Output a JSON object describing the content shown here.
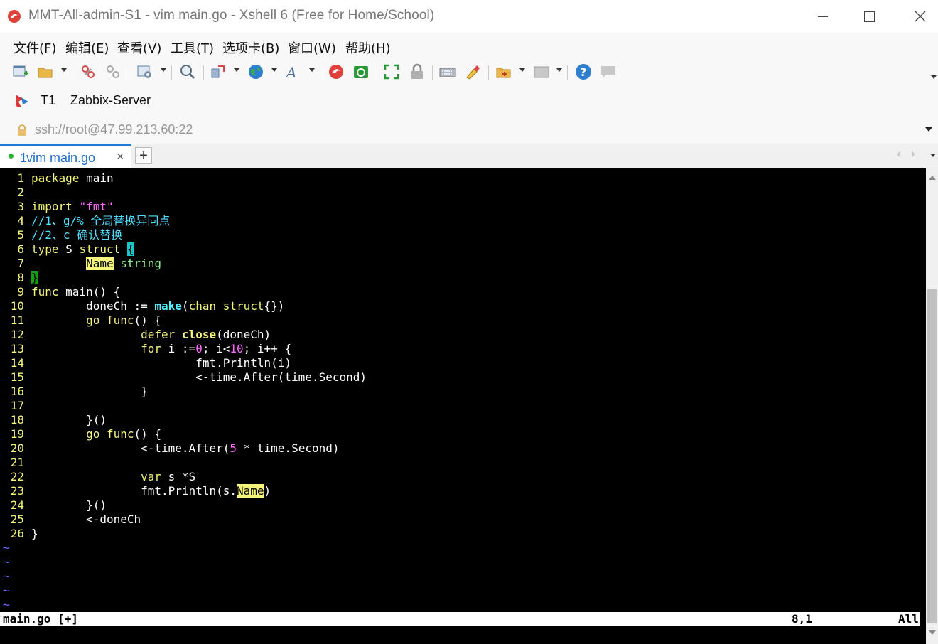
{
  "window": {
    "title": "MMT-All-admin-S1 - vim main.go - Xshell 6 (Free for Home/School)"
  },
  "menu": [
    "文件(F)",
    "编辑(E)",
    "查看(V)",
    "工具(T)",
    "选项卡(B)",
    "窗口(W)",
    "帮助(H)"
  ],
  "session": {
    "label": "T1",
    "name": "Zabbix-Server"
  },
  "address": {
    "value": "ssh://root@47.99.213.60:22"
  },
  "tab": {
    "index": "1",
    "label": " vim main.go",
    "close": "×",
    "add": "+"
  },
  "editor": {
    "status_file": "main.go [+]",
    "status_pos": "8,1",
    "status_scroll": "All",
    "tilde": "~"
  },
  "colors": {
    "accent": "#1e7bd7",
    "terminal_bg": "#000000",
    "line_number": "#f4f47a"
  },
  "code_lines": [
    {
      "n": "1",
      "t": "package main"
    },
    {
      "n": "2",
      "t": ""
    },
    {
      "n": "3",
      "t": "import \"fmt\""
    },
    {
      "n": "4",
      "t": "//1、g/% 全局替换异同点"
    },
    {
      "n": "5",
      "t": "//2、c 确认替换"
    },
    {
      "n": "6",
      "t": "type S struct {"
    },
    {
      "n": "7",
      "t": "        Name string"
    },
    {
      "n": "8",
      "t": "}"
    },
    {
      "n": "9",
      "t": "func main() {"
    },
    {
      "n": "10",
      "t": "        doneCh := make(chan struct{})"
    },
    {
      "n": "11",
      "t": "        go func() {"
    },
    {
      "n": "12",
      "t": "                defer close(doneCh)"
    },
    {
      "n": "13",
      "t": "                for i :=0; i<10; i++ {"
    },
    {
      "n": "14",
      "t": "                        fmt.Println(i)"
    },
    {
      "n": "15",
      "t": "                        <-time.After(time.Second)"
    },
    {
      "n": "16",
      "t": "                }"
    },
    {
      "n": "17",
      "t": ""
    },
    {
      "n": "18",
      "t": "        }()"
    },
    {
      "n": "19",
      "t": "        go func() {"
    },
    {
      "n": "20",
      "t": "                <-time.After(5 * time.Second)"
    },
    {
      "n": "21",
      "t": ""
    },
    {
      "n": "22",
      "t": "                var s *S"
    },
    {
      "n": "23",
      "t": "                fmt.Println(s.Name)"
    },
    {
      "n": "24",
      "t": "        }()"
    },
    {
      "n": "25",
      "t": "        <-doneCh"
    },
    {
      "n": "26",
      "t": "}"
    }
  ]
}
